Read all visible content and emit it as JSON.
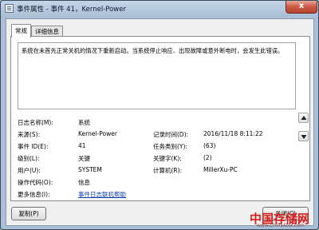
{
  "window": {
    "title": "事件属性 - 事件 41，Kernel-Power",
    "close_label": "x"
  },
  "tabs": [
    {
      "label": "常规",
      "active": true
    },
    {
      "label": "详细信息",
      "active": false
    }
  ],
  "description": "系统在未首先正常关机的情况下重新启动。当系统停止响应、出现故障或意外断电时，会发生此错误。",
  "fields": {
    "log_name": {
      "label": "日志名称(M):",
      "value": "系统"
    },
    "source": {
      "label": "来源(S):",
      "value": "Kernel-Power"
    },
    "logged": {
      "label": "记录时间(D):",
      "value": "2016/11/18 8:11:22"
    },
    "event_id": {
      "label": "事件 ID(E):",
      "value": "41"
    },
    "task_category": {
      "label": "任务类别(Y):",
      "value": "(63)"
    },
    "level": {
      "label": "级别(L):",
      "value": "关键"
    },
    "keywords": {
      "label": "关键字(K):",
      "value": "(2)"
    },
    "user": {
      "label": "用户(U):",
      "value": "SYSTEM"
    },
    "computer": {
      "label": "计算机(R):",
      "value": "MillerXu-PC"
    },
    "opcode": {
      "label": "操作代码(O):",
      "value": "信息"
    },
    "more_info": {
      "label": "更多信息(I):",
      "value": "事件日志联机帮助"
    }
  },
  "buttons": {
    "copy": "复制(P)",
    "close": "关闭(C)"
  },
  "watermark": {
    "text": "中国存储网",
    "url": "www.ChinaStor.com"
  }
}
